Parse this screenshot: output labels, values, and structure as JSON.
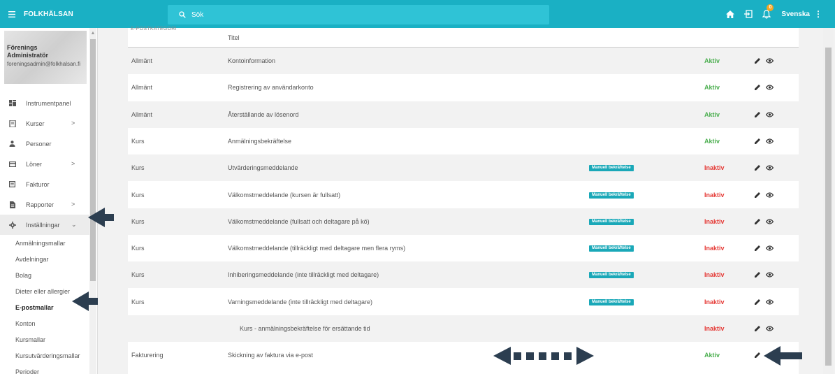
{
  "header": {
    "brand": "FOLKHÄLSAN",
    "search_placeholder": "Sök",
    "notification_count": "0",
    "language": "Svenska"
  },
  "profile": {
    "name_line1": "Förenings",
    "name_line2": "Administratör",
    "email": "foreningsadmin@folkhalsan.fi"
  },
  "sidebar": {
    "items": [
      {
        "label": "Instrumentpanel",
        "icon": "dashboard-icon"
      },
      {
        "label": "Kurser",
        "icon": "book-icon"
      },
      {
        "label": "Personer",
        "icon": "person-icon"
      },
      {
        "label": "Löner",
        "icon": "card-icon"
      },
      {
        "label": "Fakturor",
        "icon": "invoice-icon"
      },
      {
        "label": "Rapporter",
        "icon": "report-icon"
      },
      {
        "label": "Inställningar",
        "icon": "gear-icon"
      }
    ],
    "sub_items": [
      "Anmälningsmallar",
      "Avdelningar",
      "Bolag",
      "Dieter eller allergier",
      "E-postmallar",
      "Konton",
      "Kursmallar",
      "Kursutvärderingsmallar",
      "Perioder"
    ]
  },
  "table": {
    "header_small": "E-POSTKATEGORI",
    "header_title": "Titel",
    "tag_label": "Manuell bekräftelse",
    "rows": [
      {
        "category": "Allmänt",
        "title": "Kontoinformation",
        "status": "Aktiv"
      },
      {
        "category": "Allmänt",
        "title": "Registrering av användarkonto",
        "status": "Aktiv"
      },
      {
        "category": "Allmänt",
        "title": "Återställande av lösenord",
        "status": "Aktiv"
      },
      {
        "category": "Kurs",
        "title": "Anmälningsbekräftelse",
        "status": "Aktiv"
      },
      {
        "category": "Kurs",
        "title": "Utvärderingsmeddelande",
        "status": "Inaktiv",
        "tag": "Manuell bekräftelse"
      },
      {
        "category": "Kurs",
        "title": "Välkomstmeddelande (kursen är fullsatt)",
        "status": "Inaktiv",
        "tag": "Manuell bekräftelse"
      },
      {
        "category": "Kurs",
        "title": "Välkomstmeddelande (fullsatt och deltagare på kö)",
        "status": "Inaktiv",
        "tag": "Manuell bekräftelse"
      },
      {
        "category": "Kurs",
        "title": "Välkomstmeddelande (tillräckligt med deltagare men flera ryms)",
        "status": "Inaktiv",
        "tag": "Manuell bekräftelse"
      },
      {
        "category": "Kurs",
        "title": "Inhiberingsmeddelande (inte tillräckligt med deltagare)",
        "status": "Inaktiv",
        "tag": "Manuell bekräftelse"
      },
      {
        "category": "Kurs",
        "title": "Varningsmeddelande (inte tillräckligt med deltagare)",
        "status": "Inaktiv",
        "tag": "Manuell bekräftelse"
      },
      {
        "category": "",
        "title": "Kurs - anmälningsbekräftelse för ersättande tid",
        "status": "Inaktiv"
      },
      {
        "category": "Fakturering",
        "title": "Skickning av faktura via e-post",
        "status": "Aktiv"
      }
    ]
  },
  "colors": {
    "topbar": "#1ab0c4",
    "active": "#4caf50",
    "inactive": "#e53935",
    "tag": "#1aa8b8"
  }
}
